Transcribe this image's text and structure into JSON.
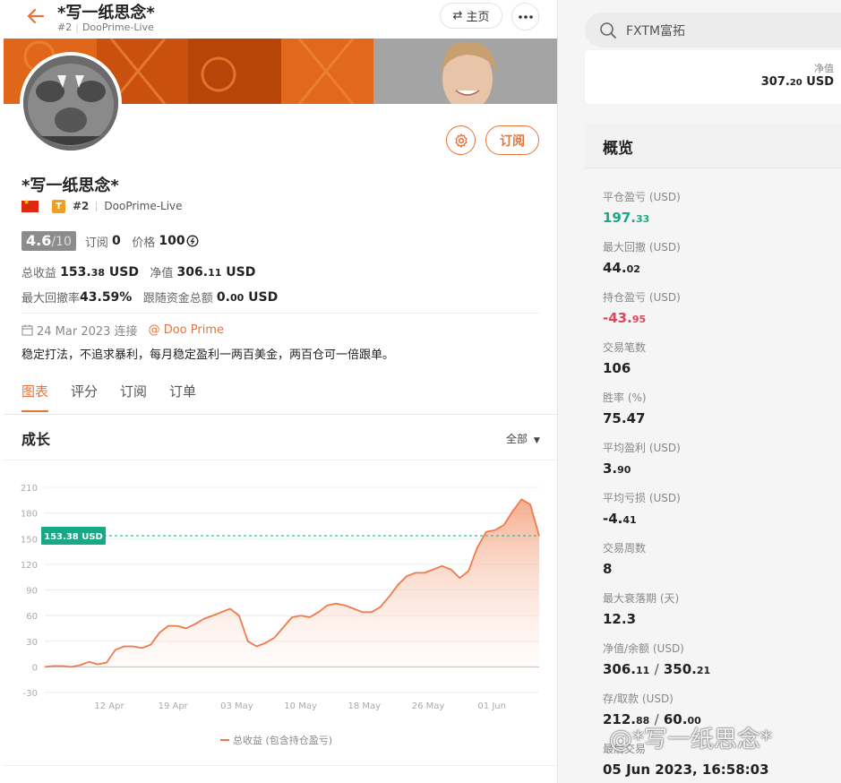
{
  "header": {
    "title": "*写一纸思念*",
    "rank": "#2",
    "server": "DooPrime-Live",
    "home_label": "主页"
  },
  "profile": {
    "name": "*写一纸思念*",
    "badge": "T",
    "rank": "#2",
    "server": "DooPrime-Live",
    "score": "4.6",
    "score_max": "/10",
    "subs_label": "订阅",
    "subs_value": "0",
    "price_label": "价格",
    "price_value": "100",
    "subscribe_label": "订阅",
    "total_profit_label": "总收益",
    "total_profit_int": "153.",
    "total_profit_dec": "38",
    "total_profit_unit": "USD",
    "equity_label": "净值",
    "equity_int": "306.",
    "equity_dec": "11",
    "equity_unit": "USD",
    "max_dd_label": "最大回撤率",
    "max_dd_value": "43.59%",
    "follow_label": "跟随资金总额",
    "follow_int": "0.",
    "follow_dec": "00",
    "follow_unit": "USD",
    "joined": "24 Mar 2023 连接",
    "broker": "@ Doo Prime",
    "description": "稳定打法，不追求暴利，每月稳定盈利一两百美金，两百仓可一倍跟单。"
  },
  "tabs": [
    {
      "label": "图表",
      "active": true
    },
    {
      "label": "评分",
      "active": false
    },
    {
      "label": "订阅",
      "active": false
    },
    {
      "label": "订单",
      "active": false
    }
  ],
  "growth": {
    "title": "成长",
    "range": "全部"
  },
  "chart_data": {
    "type": "area",
    "y_ticks": [
      "210",
      "180",
      "150",
      "120",
      "90",
      "60",
      "30",
      "0",
      "-30"
    ],
    "ylim": [
      -30,
      210
    ],
    "x_ticks": [
      "12 Apr",
      "19 Apr",
      "03 May",
      "10 May",
      "18 May",
      "26 May",
      "01 Jun"
    ],
    "current_label": "153.38 USD",
    "current_value": 153.38,
    "legend": "总收益 (包含持仓盈亏)",
    "color": "#f07a4a",
    "values": [
      0,
      1,
      1,
      0,
      2,
      6,
      3,
      5,
      20,
      24,
      24,
      22,
      26,
      40,
      48,
      48,
      45,
      50,
      56,
      60,
      64,
      68,
      60,
      30,
      24,
      28,
      34,
      46,
      58,
      60,
      58,
      64,
      72,
      74,
      72,
      68,
      64,
      64,
      70,
      82,
      96,
      106,
      110,
      110,
      114,
      118,
      114,
      104,
      112,
      140,
      158,
      160,
      166,
      182,
      196,
      190,
      153
    ]
  },
  "search": {
    "placeholder": "FXTM富拓"
  },
  "top_card": {
    "label": "净值",
    "value_int": "307.",
    "value_dec": "20",
    "unit": "USD"
  },
  "overview": {
    "title": "概览",
    "items": [
      {
        "label": "平仓盈亏 (USD)",
        "int": "197.",
        "dec": "33",
        "tone": "green"
      },
      {
        "label": "最大回撤 (USD)",
        "int": "44.",
        "dec": "02",
        "tone": ""
      },
      {
        "label": "持仓盈亏 (USD)",
        "int": "-43.",
        "dec": "95",
        "tone": "red"
      },
      {
        "label": "交易笔数",
        "int": "106",
        "dec": "",
        "tone": ""
      },
      {
        "label": "胜率 (%)",
        "int": "75.47",
        "dec": "",
        "tone": ""
      },
      {
        "label": "平均盈利 (USD)",
        "int": "3.",
        "dec": "90",
        "tone": ""
      },
      {
        "label": "平均亏损 (USD)",
        "int": "-4.",
        "dec": "41",
        "tone": ""
      },
      {
        "label": "交易周数",
        "int": "8",
        "dec": "",
        "tone": ""
      },
      {
        "label": "最大衰落期 (天)",
        "int": "12.3",
        "dec": "",
        "tone": ""
      },
      {
        "label": "净值/余额 (USD)",
        "int": "306.",
        "dec": "11",
        "tone": "",
        "int2": "350.",
        "dec2": "21"
      },
      {
        "label": "存/取款 (USD)",
        "int": "212.",
        "dec": "88",
        "tone": "",
        "int2": "60.",
        "dec2": "00"
      },
      {
        "label": "最后交易",
        "int": "05 Jun 2023, 16:58:03",
        "dec": "",
        "tone": ""
      }
    ]
  },
  "watermark": "@*写一纸思念*"
}
